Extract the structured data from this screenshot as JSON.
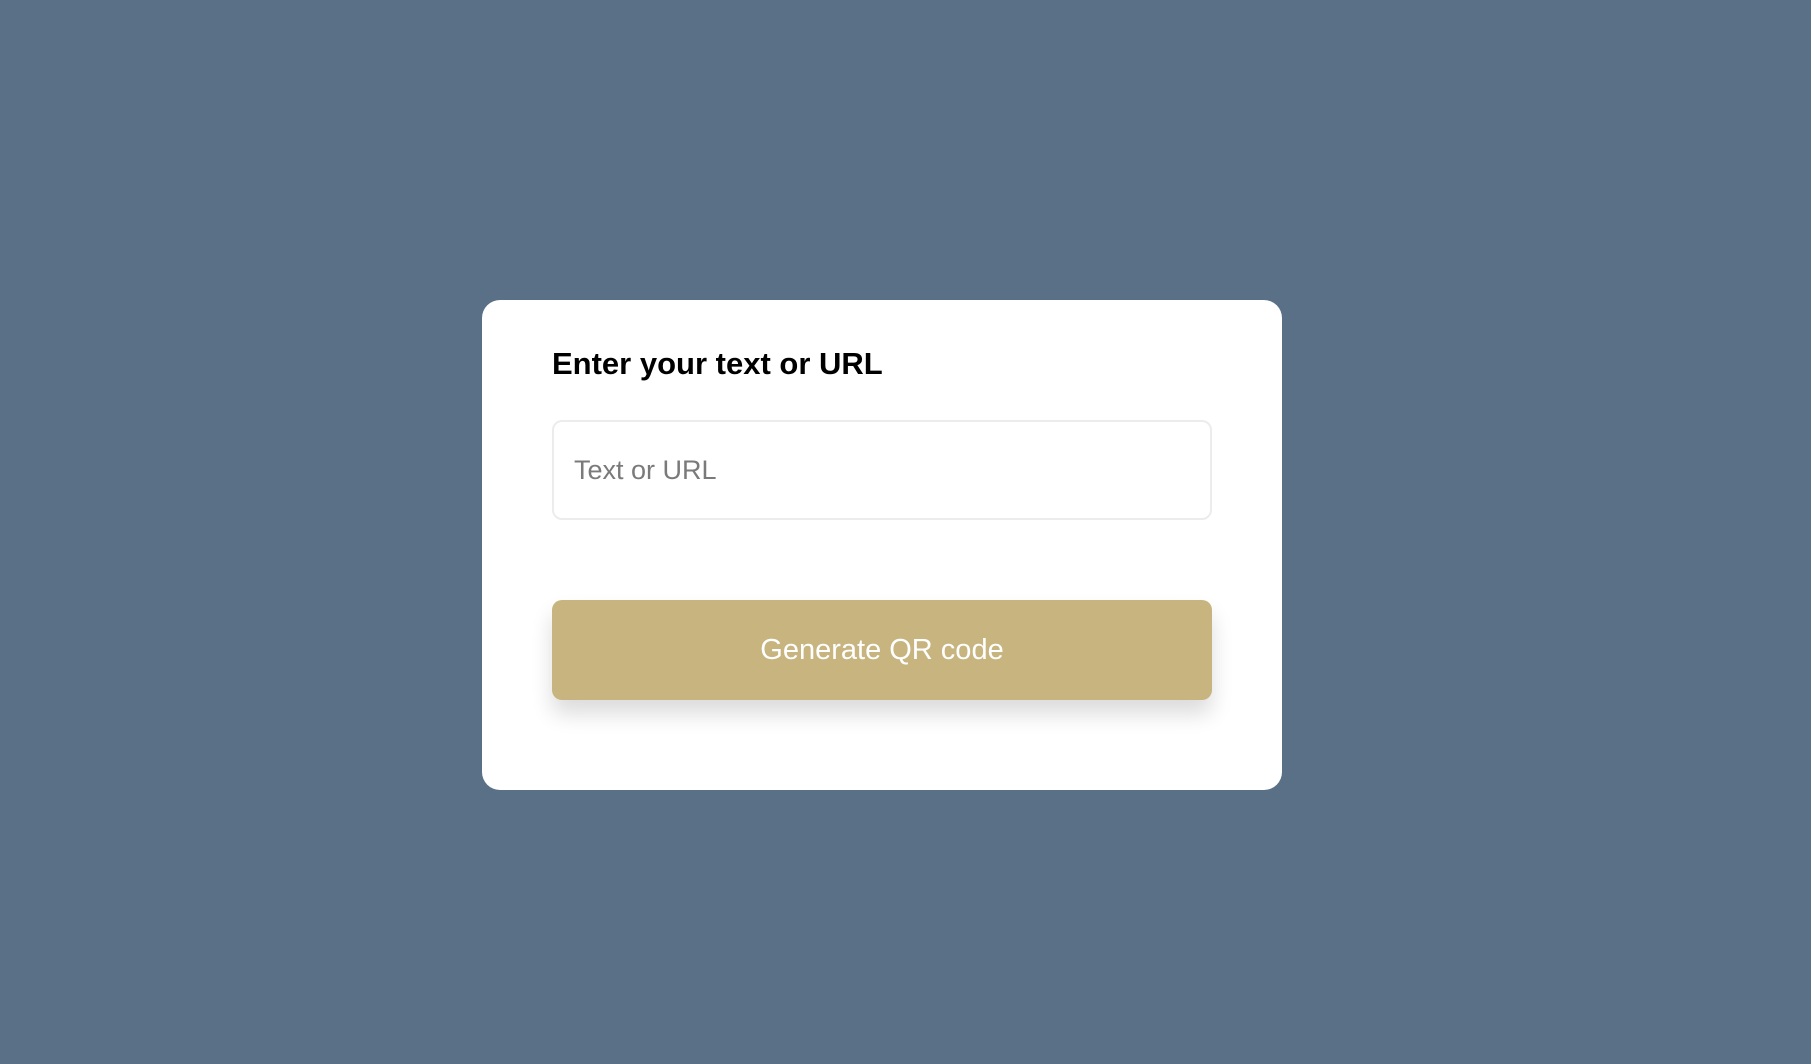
{
  "colors": {
    "page_background": "#5a7087",
    "card_background": "#ffffff",
    "button_background": "#c7b47f",
    "button_text": "#ffffff",
    "input_border": "#ececec"
  },
  "form": {
    "title": "Enter your text or URL",
    "input": {
      "value": "",
      "placeholder": "Text or URL"
    },
    "generate_label": "Generate QR code"
  }
}
